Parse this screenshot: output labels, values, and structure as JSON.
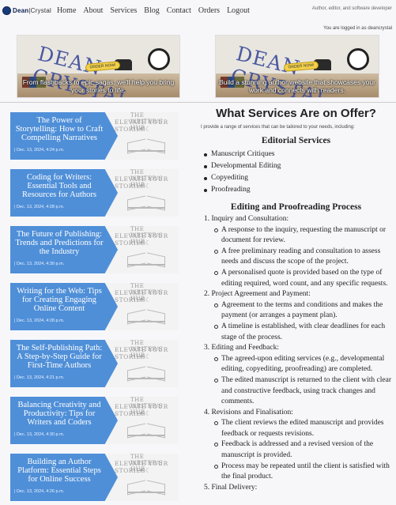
{
  "header": {
    "brand_bold": "Dean",
    "brand_rest": "Crystal",
    "nav": [
      "Home",
      "About",
      "Services",
      "Blog",
      "Contact",
      "Orders",
      "Logout"
    ],
    "tagline": "Author, editor, and software developer",
    "logged_in": "You are logged in as deancrystal"
  },
  "banners": [
    {
      "title": "DEAN CRYSTAL",
      "cta": "ORDER NOW!",
      "text": "From flashbacks to epic sagas, we'll help you bring your stories to life."
    },
    {
      "title": "DEAN CRYSTAL",
      "cta": "ORDER NOW!",
      "text": "Build a stunning author website that showcases your work and connects with readers."
    }
  ],
  "sidebar": {
    "art_line1": "THE WRITER'S HUB",
    "art_line2": "ELEVATE YOUR STORIES",
    "posts": [
      {
        "title": "The Power of Storytelling: How to Craft Compelling Narratives",
        "date": "| Dec. 13, 2024, 4:24 p.m."
      },
      {
        "title": "Coding for Writers: Essential Tools and Resources for Authors",
        "date": "| Dec. 13, 2024, 4:28 p.m."
      },
      {
        "title": "The Future of Publishing: Trends and Predictions for the Industry",
        "date": "| Dec. 13, 2024, 4:30 p.m."
      },
      {
        "title": "Writing for the Web: Tips for Creating Engaging Online Content",
        "date": "| Dec. 13, 2024, 4:28 p.m."
      },
      {
        "title": "The Self-Publishing Path: A Step-by-Step Guide for First-Time Authors",
        "date": "| Dec. 13, 2024, 4:21 p.m."
      },
      {
        "title": "Balancing Creativity and Productivity: Tips for Writers and Coders",
        "date": "| Dec. 13, 2024, 4:30 p.m."
      },
      {
        "title": "Building an Author Platform: Essential Steps for Online Success",
        "date": "| Dec. 13, 2024, 4:26 p.m."
      }
    ]
  },
  "main": {
    "title": "What Services Are on Offer?",
    "intro": "I provide a range of services that can be tailored to your needs, including:",
    "editorial_heading": "Editorial Services",
    "editorial_items": [
      "Manuscript Critiques",
      "Developmental Editing",
      "Copyediting",
      "Proofreading"
    ],
    "process_heading": "Editing and Proofreading Process",
    "steps": [
      {
        "label": "1. Inquiry and Consultation:",
        "items": [
          "A response to the inquiry, requesting the manuscript or document for review.",
          "A free preliminary reading and consultation to assess needs and discuss the scope of the project.",
          "A personalised quote is provided based on the type of editing required, word count, and any specific requests."
        ]
      },
      {
        "label": "2. Project Agreement and Payment:",
        "items": [
          "Agreement to the terms and conditions and makes the payment (or arranges a payment plan).",
          "A timeline is established, with clear deadlines for each stage of the process."
        ]
      },
      {
        "label": "3. Editing and Feedback:",
        "items": [
          "The agreed-upon editing services (e.g., developmental editing, copyediting, proofreading) are completed.",
          "The edited manuscript is returned to the client with clear and constructive feedback, using track changes and comments."
        ]
      },
      {
        "label": "4. Revisions and Finalisation:",
        "items": [
          "The client reviews the edited manuscript and provides feedback or requests revisions.",
          "Feedback is addressed and a revised version of the manuscript is provided.",
          "Process may be repeated until the client is satisfied with the final product."
        ]
      },
      {
        "label": "5. Final Delivery:",
        "items": []
      }
    ]
  }
}
